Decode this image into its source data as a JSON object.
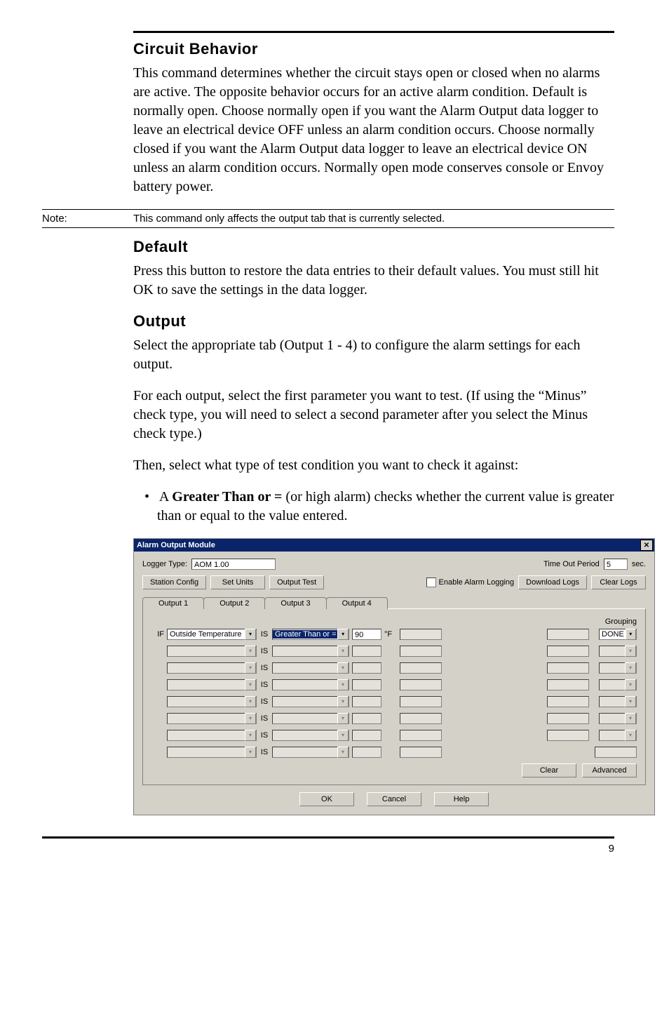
{
  "section1": {
    "heading": "Circuit Behavior",
    "paragraph": "This command determines whether the circuit stays open or closed when no alarms are active. The opposite behavior occurs for an active alarm condition. Default is normally open. Choose normally open if you want the Alarm Output data logger to leave an electrical device OFF unless an alarm condition occurs. Choose normally closed if you want the Alarm Output data logger to leave an electrical device ON unless an alarm condition occurs. Normally open mode conserves console or Envoy battery power."
  },
  "note": {
    "label": "Note:",
    "text": "This command only affects the output tab that is currently selected."
  },
  "section2": {
    "heading": "Default",
    "paragraph": "Press this button to restore the data entries to their default values. You must still hit OK to save the settings in the data logger."
  },
  "section3": {
    "heading": "Output",
    "p1": "Select the appropriate tab (Output 1 - 4) to configure the alarm settings for each output.",
    "p2": "For each output, select the first parameter you want to test. (If using the “Minus” check type, you will need to select a second parameter after you select the Minus check type.)",
    "p3": "Then, select what type of test condition you want to check it against:",
    "bullet_lead": "A ",
    "bullet_bold": "Greater Than or =",
    "bullet_tail": " (or high alarm) checks whether the current value is greater than or equal to the value entered."
  },
  "dlg": {
    "title": "Alarm Output Module",
    "logger_type_label": "Logger Type:",
    "logger_type_value": "AOM  1.00",
    "time_out_label": "Time Out Period",
    "time_out_value": "5",
    "time_out_unit": "sec.",
    "enable_alarm_label": "Enable Alarm Logging",
    "buttons": {
      "station_config": "Station Config",
      "set_units": "Set Units",
      "output_test": "Output Test",
      "download_logs": "Download Logs",
      "clear_logs": "Clear Logs",
      "clear": "Clear",
      "advanced": "Advanced",
      "ok": "OK",
      "cancel": "Cancel",
      "help": "Help"
    },
    "tabs": [
      "Output 1",
      "Output 2",
      "Output 3",
      "Output 4"
    ],
    "grouping_label": "Grouping",
    "rows": [
      {
        "if": "IF",
        "param": "Outside Temperature",
        "is": "IS",
        "cond": "Greater Than or =",
        "val": "90",
        "unit": "°F",
        "grouping": "DONE",
        "enabled": true,
        "hl_cond": true
      },
      {
        "if": "",
        "param": "",
        "is": "IS",
        "cond": "",
        "val": "",
        "unit": "",
        "grouping": "",
        "enabled": false,
        "hl_cond": false
      },
      {
        "if": "",
        "param": "",
        "is": "IS",
        "cond": "",
        "val": "",
        "unit": "",
        "grouping": "",
        "enabled": false,
        "hl_cond": false
      },
      {
        "if": "",
        "param": "",
        "is": "IS",
        "cond": "",
        "val": "",
        "unit": "",
        "grouping": "",
        "enabled": false,
        "hl_cond": false
      },
      {
        "if": "",
        "param": "",
        "is": "IS",
        "cond": "",
        "val": "",
        "unit": "",
        "grouping": "",
        "enabled": false,
        "hl_cond": false
      },
      {
        "if": "",
        "param": "",
        "is": "IS",
        "cond": "",
        "val": "",
        "unit": "",
        "grouping": "",
        "enabled": false,
        "hl_cond": false
      },
      {
        "if": "",
        "param": "",
        "is": "IS",
        "cond": "",
        "val": "",
        "unit": "",
        "grouping": "",
        "enabled": false,
        "hl_cond": false
      },
      {
        "if": "",
        "param": "",
        "is": "IS",
        "cond": "",
        "val": "",
        "unit": "",
        "grouping": "",
        "enabled": false,
        "hl_cond": false
      }
    ]
  },
  "page_number": "9"
}
